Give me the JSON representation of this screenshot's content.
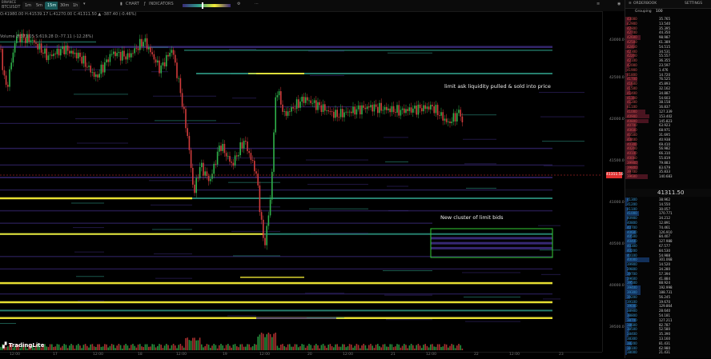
{
  "toolbar": {
    "symbol_line1": "BINANCE",
    "symbol_line2": "BTCUSDT",
    "timeframes": [
      "1m",
      "5m",
      "15m",
      "30m",
      "1h"
    ],
    "active_timeframe": "15m",
    "chart_label": "CHART",
    "indicators_label": "INDICATORS"
  },
  "ohlc": "O:41980.00 H:41539.17 L:41270.00 C:41311.50 ▲ -387.40 (-0.46%)",
  "volume_label": "Volume  B:371.05  S:619.28  D:-77.11  (-12.28%)",
  "annotations": {
    "ask_pulled": "limit ask liquidity pulled & sold into price",
    "bid_cluster": "New cluster of limit bids"
  },
  "logo": "TradingLite",
  "price_axis": {
    "ticks": [
      "43000.00",
      "42500.00",
      "42000.00",
      "41500.00",
      "41000.00",
      "40500.00",
      "40000.00",
      "39500.00"
    ],
    "current": "41311.50"
  },
  "time_axis": {
    "ticks": [
      "12:00",
      "17",
      "12:00",
      "18",
      "12:00",
      "19",
      "12:00",
      "20",
      "12:00",
      "21",
      "12:00",
      "22",
      "12:00",
      "23"
    ]
  },
  "orderbook": {
    "title": "ORDERBOOK",
    "tab2": "SETTINGS",
    "grouping_label": "Grouping",
    "grouping_value": "100",
    "mid_price": "41311.50",
    "asks": [
      [
        "43000",
        "35.765"
      ],
      [
        "42900",
        "13.540"
      ],
      [
        "42800",
        "35.395"
      ],
      [
        "42700",
        "44.350"
      ],
      [
        "42600",
        "98.987"
      ],
      [
        "42500",
        "61.389"
      ],
      [
        "42400",
        "54.515"
      ],
      [
        "42300",
        "34.531"
      ],
      [
        "42200",
        "55.557"
      ],
      [
        "42100",
        "36.355"
      ],
      [
        "42000",
        "23.597"
      ],
      [
        "41900",
        "1.476"
      ],
      [
        "41800",
        "14.720"
      ],
      [
        "41700",
        "76.525"
      ],
      [
        "41600",
        "45.893"
      ],
      [
        "41500",
        "32.162"
      ],
      [
        "41400",
        "34.887"
      ],
      [
        "41300",
        "54.603"
      ],
      [
        "41200",
        "38.158"
      ],
      [
        "41100",
        "16.837"
      ],
      [
        "41000",
        "127.339"
      ],
      [
        "40900",
        "153.402"
      ],
      [
        "40800",
        "145.823"
      ],
      [
        "40700",
        "63.923"
      ],
      [
        "40600",
        "68.971"
      ],
      [
        "40500",
        "31.695"
      ],
      [
        "40400",
        "40.938"
      ],
      [
        "40300",
        "69.410"
      ],
      [
        "40200",
        "56.982"
      ],
      [
        "40100",
        "66.310"
      ],
      [
        "40000",
        "55.819"
      ],
      [
        "39900",
        "79.883"
      ],
      [
        "39800",
        "83.679"
      ],
      [
        "39700",
        "35.833"
      ],
      [
        "39600",
        "140.683"
      ]
    ],
    "bids": [
      [
        "41300",
        "38.962"
      ],
      [
        "41200",
        "14.550"
      ],
      [
        "41100",
        "30.057"
      ],
      [
        "41000",
        "170.771"
      ],
      [
        "40900",
        "34.212"
      ],
      [
        "40800",
        "12.891"
      ],
      [
        "40700",
        "74.461"
      ],
      [
        "40600",
        "126.910"
      ],
      [
        "40500",
        "84.407"
      ],
      [
        "40400",
        "127.988"
      ],
      [
        "40300",
        "67.577"
      ],
      [
        "40200",
        "84.530"
      ],
      [
        "40100",
        "54.988"
      ],
      [
        "40000",
        "301.068"
      ],
      [
        "39900",
        "14.520"
      ],
      [
        "39800",
        "34.280"
      ],
      [
        "39700",
        "57.394"
      ],
      [
        "39600",
        "41.884"
      ],
      [
        "39500",
        "88.924"
      ],
      [
        "39400",
        "192.998"
      ],
      [
        "39300",
        "188.731"
      ],
      [
        "39200",
        "56.245"
      ],
      [
        "39100",
        "19.670"
      ],
      [
        "39000",
        "129.864"
      ],
      [
        "38900",
        "28.640"
      ],
      [
        "38800",
        "54.181"
      ],
      [
        "38700",
        "127.211"
      ],
      [
        "38600",
        "82.787"
      ],
      [
        "38500",
        "52.580"
      ],
      [
        "38400",
        "35.390"
      ],
      [
        "38300",
        "13.160"
      ],
      [
        "38200",
        "81.431"
      ],
      [
        "38100",
        "62.980"
      ],
      [
        "38000",
        "21.431"
      ]
    ]
  },
  "colors": {
    "bull": "#2fb14a",
    "bear": "#d23b3b",
    "heat_yellow": "#f2ea35",
    "heat_teal": "#2f9f8a",
    "heat_purple": "#3a2a7a",
    "box": "#33cc33"
  }
}
